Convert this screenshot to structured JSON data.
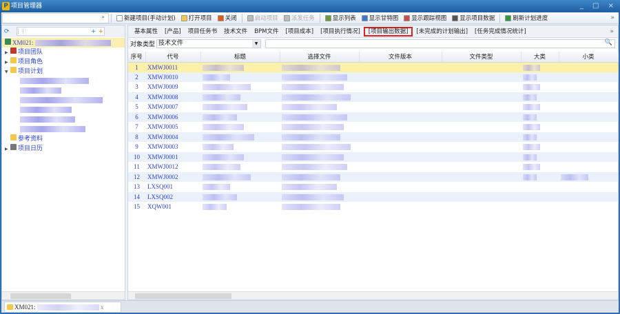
{
  "window": {
    "title": "项目管理器",
    "controls": "_ □ ×"
  },
  "toolbar": {
    "collapse": "»",
    "items": [
      {
        "label": "新建项目(手动计划)",
        "icon": "new-doc-icon",
        "color": "#ffffff",
        "disabled": false
      },
      {
        "label": "打开项目",
        "icon": "folder-open-icon",
        "color": "#f2c94c",
        "disabled": false
      },
      {
        "label": "关闭",
        "icon": "close-x-icon",
        "color": "#e05a1a",
        "disabled": false
      },
      {
        "label": "启动项目",
        "icon": "start-icon",
        "color": "#bbbbbb",
        "disabled": true
      },
      {
        "label": "派发任务",
        "icon": "dispatch-icon",
        "color": "#bbbbbb",
        "disabled": true
      },
      {
        "label": "显示列表",
        "icon": "list-icon",
        "color": "#6a9a3a",
        "disabled": false
      },
      {
        "label": "显示甘特图",
        "icon": "gantt-icon",
        "color": "#3a7ad0",
        "disabled": false
      },
      {
        "label": "显示跟踪视图",
        "icon": "tracking-icon",
        "color": "#d04a4a",
        "disabled": false
      },
      {
        "label": "显示项目数据",
        "icon": "data-icon",
        "color": "#555555",
        "disabled": false
      },
      {
        "label": "刷新计划进度",
        "icon": "refresh-icon",
        "color": "#2a9a3a",
        "disabled": false
      }
    ],
    "more": "»"
  },
  "left": {
    "tree": [
      {
        "label": "XM021:",
        "selected": true
      },
      {
        "label": "项目团队",
        "arrow": "▶"
      },
      {
        "label": "项目角色",
        "arrow": "▶"
      },
      {
        "label": "项目计划",
        "arrow": "▼"
      },
      {
        "label": "参考资料",
        "arrow": ""
      },
      {
        "label": "项目日历",
        "arrow": "▶"
      }
    ]
  },
  "tabs": [
    "基本属性",
    "[产品]",
    "项目任务书",
    "技术文件",
    "BPM文件",
    "[项目成本]",
    "[项目执行情况]",
    "[项目输出数据]",
    "[未完成的计划输出]",
    "[任务完成情况统计]"
  ],
  "active_tab": "[项目输出数据]",
  "filter": {
    "label": "对象类型",
    "value": "技术文件"
  },
  "table": {
    "columns": [
      "序号",
      "代号",
      "标题",
      "选择文件",
      "文件版本",
      "文件类型",
      "大类",
      "小类"
    ],
    "rows": [
      [
        "1",
        "XMWJ0011"
      ],
      [
        "2",
        "XMWJ0010"
      ],
      [
        "3",
        "XMWJ0009"
      ],
      [
        "4",
        "XMWJ0008"
      ],
      [
        "5",
        "XMWJ0007"
      ],
      [
        "6",
        "XMWJ0006"
      ],
      [
        "7",
        "XMWJ0005"
      ],
      [
        "8",
        "XMWJ0004"
      ],
      [
        "9",
        "XMWJ0003"
      ],
      [
        "10",
        "XMWJ0001"
      ],
      [
        "11",
        "XMWJ0012"
      ],
      [
        "12",
        "XMWJ0002"
      ],
      [
        "13",
        "LXSQ001"
      ],
      [
        "14",
        "LXSQ002"
      ],
      [
        "15",
        "XQW001"
      ]
    ]
  },
  "bottom_tab": {
    "label": "XM021:",
    "close": "x"
  }
}
